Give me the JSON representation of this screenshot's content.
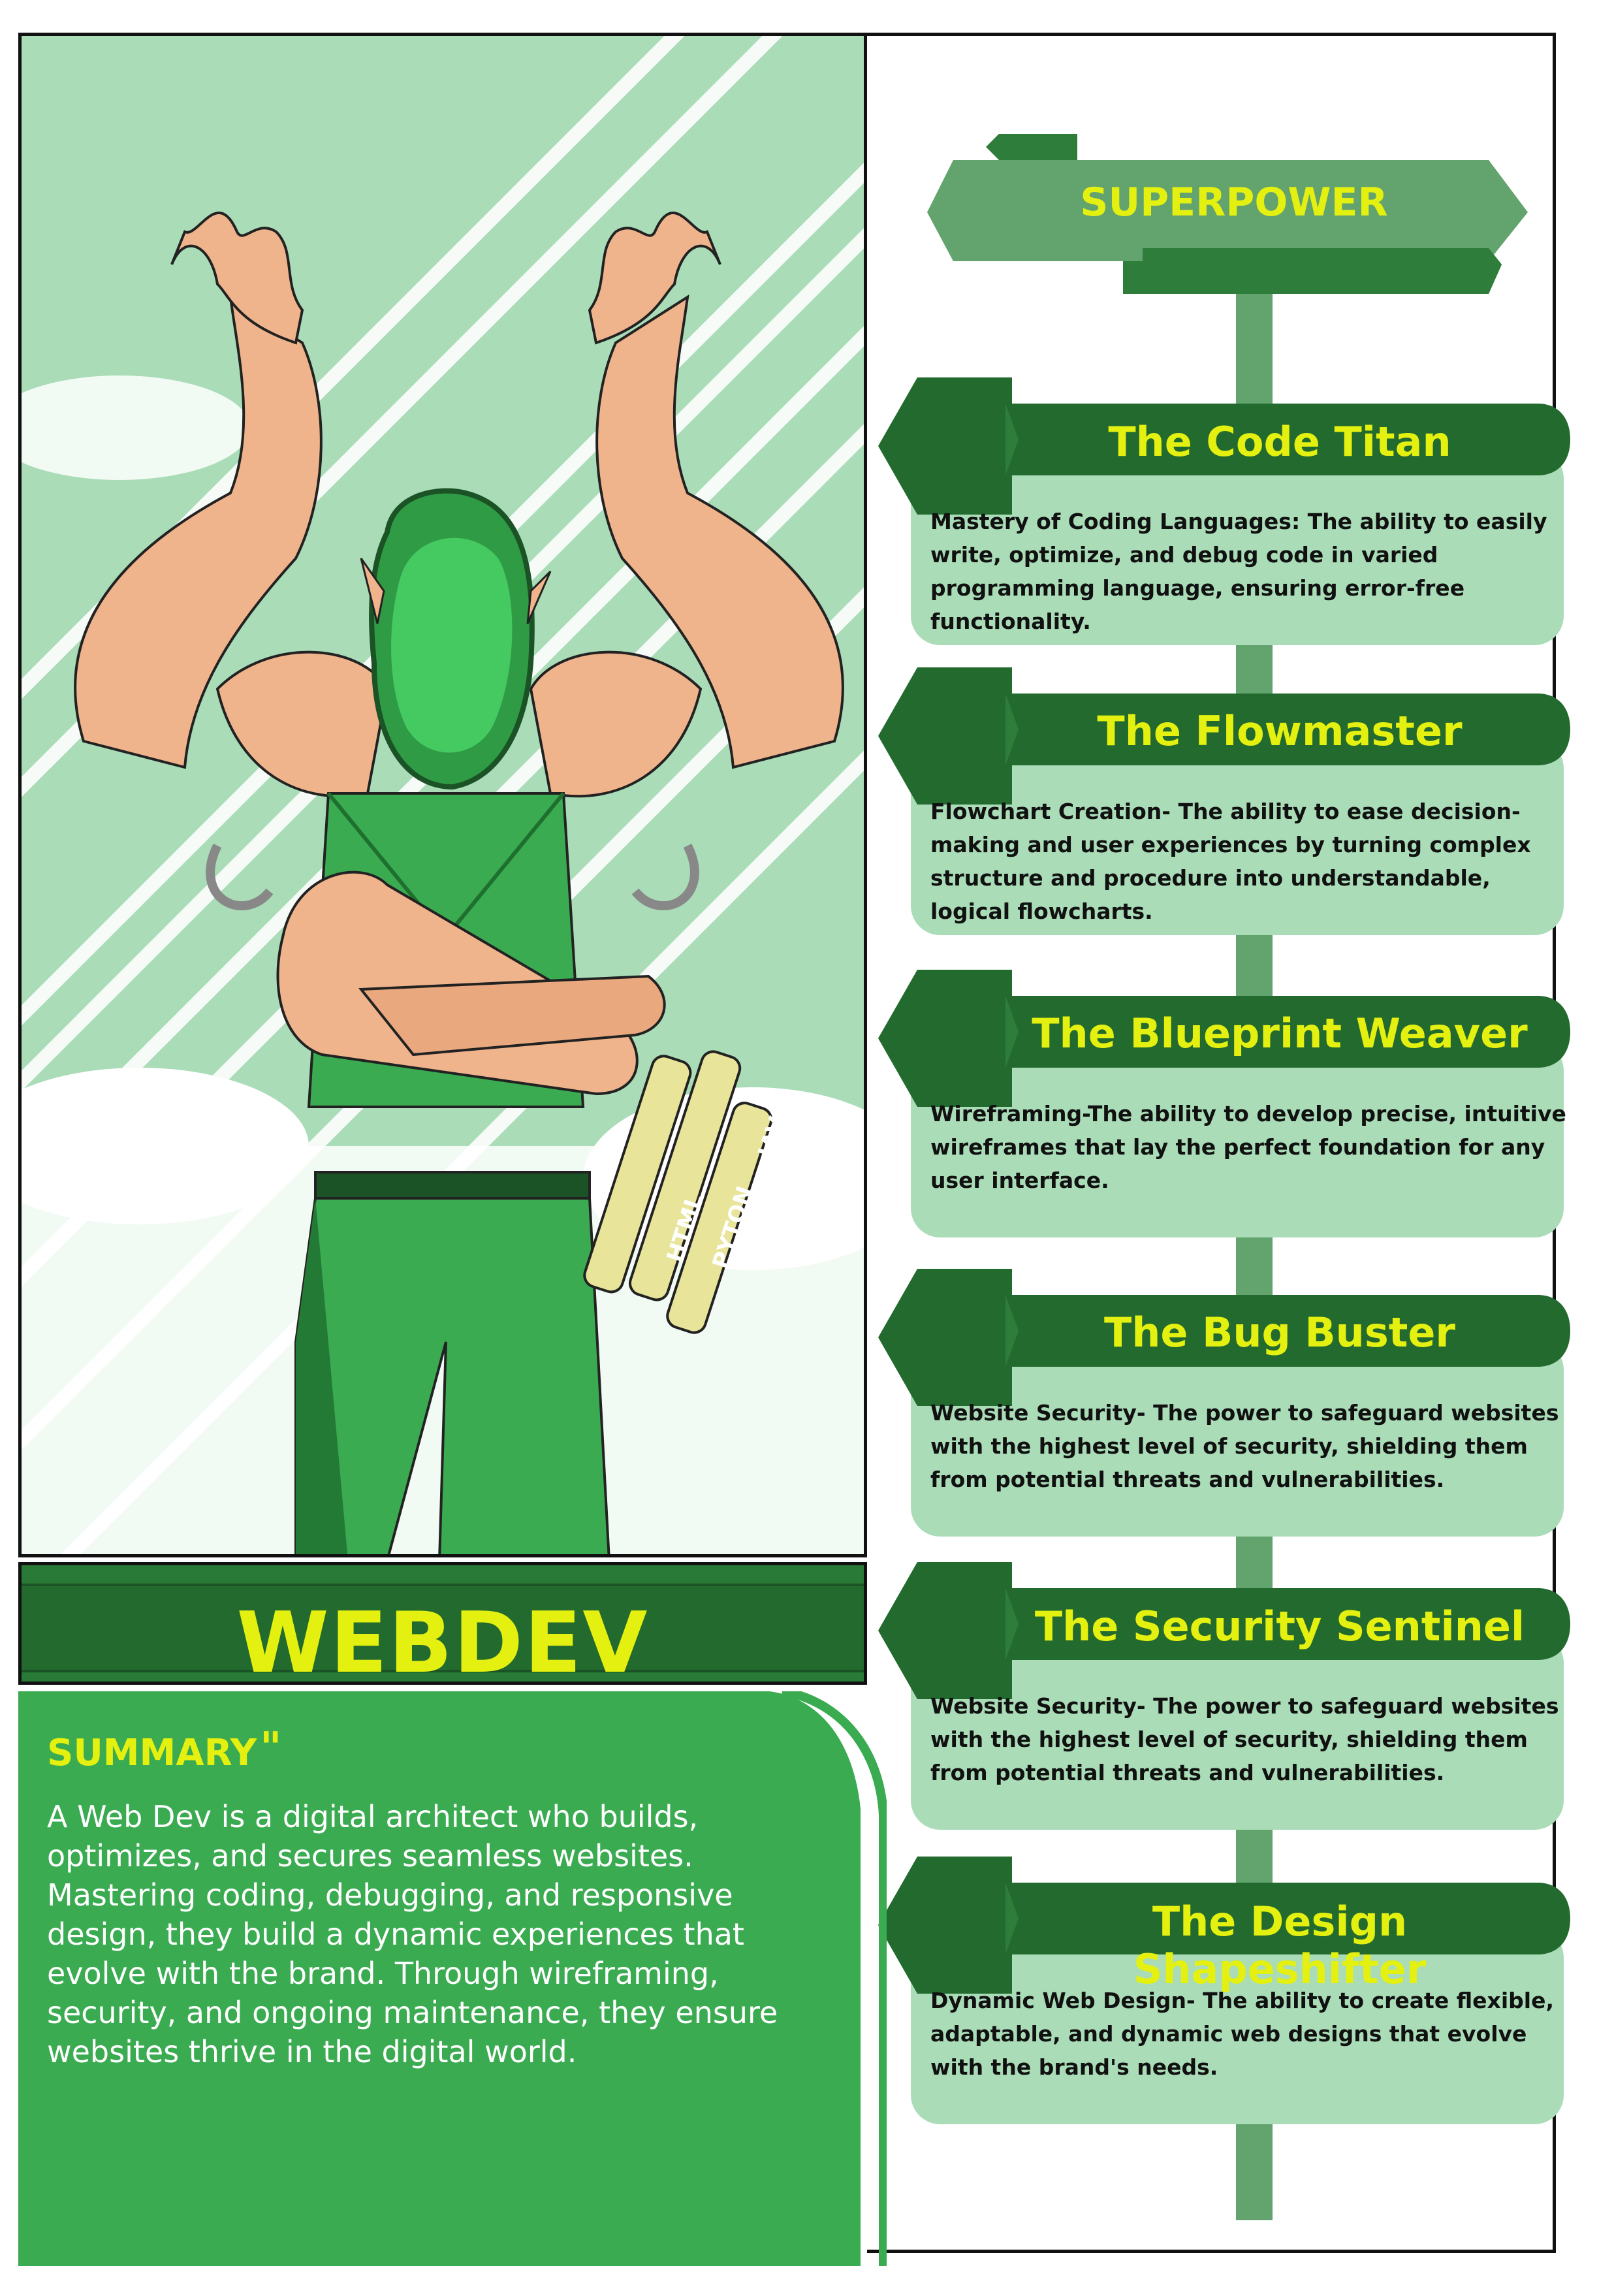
{
  "hero": {
    "name": "WEBDEV",
    "scroll_labels": [
      "HTML",
      "PYTON",
      "JAVA"
    ]
  },
  "summary": {
    "title": "SUMMARY",
    "quote_mark": "\"",
    "text": "A Web Dev is a digital architect who builds, optimizes, and secures seamless websites. Mastering coding, debugging, and responsive design, they build a dynamic experiences that evolve with the brand. Through wireframing, security, and ongoing maintenance, they ensure websites thrive in the digital world."
  },
  "superpower": {
    "label": "SUPERPOWER",
    "items": [
      {
        "title": "The Code Titan",
        "description": "Mastery of Coding Languages: The ability to easily write, optimize, and debug code in varied programming language, ensuring error-free functionality."
      },
      {
        "title": "The Flowmaster",
        "description": "Flowchart Creation- The ability to ease decision-making and user experiences by turning complex structure and procedure into understandable, logical flowcharts."
      },
      {
        "title": "The Blueprint Weaver",
        "description": "Wireframing-The ability to develop precise, intuitive wireframes that lay the perfect foundation for any user interface."
      },
      {
        "title": "The Bug Buster",
        "description": "Website Security- The power to safeguard websites with the highest level of security, shielding them from potential threats and vulnerabilities."
      },
      {
        "title": "The Security Sentinel",
        "description": "Website Security- The power to safeguard websites with the highest level of security, shielding them from potential threats and vulnerabilities."
      },
      {
        "title": "The Design Shapeshifter",
        "description": "Dynamic Web Design- The ability to create flexible, adaptable, and dynamic web designs that evolve with the brand's needs."
      }
    ]
  },
  "colors": {
    "accent_yellow": "#e4f00f",
    "dark_green": "#236a2f",
    "mid_green": "#62a36e",
    "light_green": "#a9dcb7",
    "bright_green": "#3aab50"
  }
}
